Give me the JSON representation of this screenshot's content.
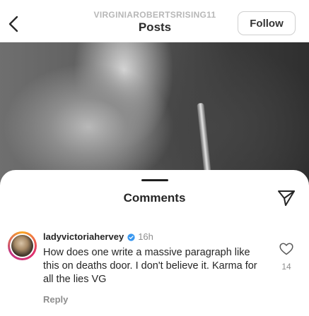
{
  "header": {
    "username": "VIRGINIAROBERTSRISING11",
    "title": "Posts",
    "follow_label": "Follow",
    "back_icon": "chevron-left-icon"
  },
  "sheet": {
    "title": "Comments",
    "share_icon": "paper-plane-icon"
  },
  "comment": {
    "username": "ladyvictoriahervey",
    "verified": true,
    "time": "16h",
    "text": "How does one write a massive paragraph like this on deaths door. I don't believe it. Karma for all the lies VG",
    "reply_label": "Reply",
    "like_count": "14",
    "like_icon": "heart-outline-icon"
  },
  "colors": {
    "verified_blue": "#3897f0",
    "text_primary": "#262626",
    "text_secondary": "#8e8e8e"
  }
}
